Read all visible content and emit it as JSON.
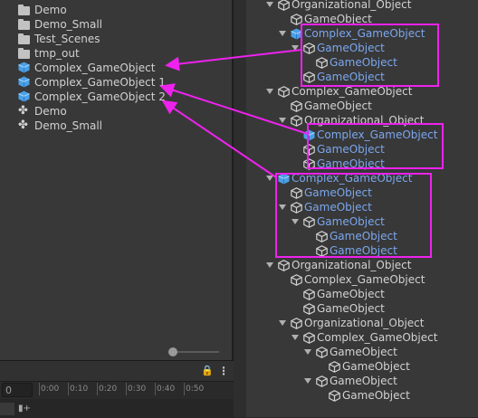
{
  "project": {
    "items": [
      {
        "label": "Demo",
        "icon": "folder-icon"
      },
      {
        "label": "Demo_Small",
        "icon": "folder-icon"
      },
      {
        "label": "Test_Scenes",
        "icon": "folder-icon"
      },
      {
        "label": "tmp_out",
        "icon": "folder-icon"
      },
      {
        "label": "Complex_GameObject",
        "icon": "prefab-cube-icon"
      },
      {
        "label": "Complex_GameObject 1",
        "icon": "prefab-cube-icon"
      },
      {
        "label": "Complex_GameObject 2",
        "icon": "prefab-cube-icon"
      },
      {
        "label": "Demo",
        "icon": "unity-scene-icon"
      },
      {
        "label": "Demo_Small",
        "icon": "unity-scene-icon"
      }
    ]
  },
  "timeline": {
    "frame_value": "0",
    "ruler_ticks": [
      "0:00",
      "0:10",
      "0:20",
      "0:30",
      "0:40",
      "0:50"
    ]
  },
  "hierarchy": {
    "rows": [
      {
        "label": "Organizational_Object",
        "depth": 0,
        "expanded": true,
        "kind": "plain",
        "color": "white"
      },
      {
        "label": "GameObject",
        "depth": 1,
        "expanded": false,
        "kind": "plain",
        "color": "white"
      },
      {
        "label": "Complex_GameObject",
        "depth": 1,
        "expanded": true,
        "kind": "prefab",
        "color": "blue"
      },
      {
        "label": "GameObject",
        "depth": 2,
        "expanded": true,
        "kind": "plain",
        "color": "blue"
      },
      {
        "label": "GameObject",
        "depth": 3,
        "expanded": false,
        "kind": "plain",
        "color": "blue"
      },
      {
        "label": "GameObject",
        "depth": 2,
        "expanded": false,
        "kind": "plain",
        "color": "blue"
      },
      {
        "label": "Complex_GameObject",
        "depth": 0,
        "expanded": true,
        "kind": "plain",
        "color": "white"
      },
      {
        "label": "GameObject",
        "depth": 1,
        "expanded": false,
        "kind": "plain",
        "color": "white"
      },
      {
        "label": "Organizational_Object",
        "depth": 1,
        "expanded": true,
        "kind": "plain",
        "color": "white"
      },
      {
        "label": "Complex_GameObject",
        "depth": 2,
        "expanded": false,
        "kind": "prefab",
        "color": "blue"
      },
      {
        "label": "GameObject",
        "depth": 2,
        "expanded": false,
        "kind": "plain",
        "color": "blue"
      },
      {
        "label": "GameObject",
        "depth": 2,
        "expanded": false,
        "kind": "plain",
        "color": "blue"
      },
      {
        "label": "Complex_GameObject",
        "depth": 0,
        "expanded": true,
        "kind": "prefab",
        "color": "blue"
      },
      {
        "label": "GameObject",
        "depth": 1,
        "expanded": false,
        "kind": "plain",
        "color": "blue"
      },
      {
        "label": "GameObject",
        "depth": 1,
        "expanded": true,
        "kind": "plain",
        "color": "blue"
      },
      {
        "label": "GameObject",
        "depth": 2,
        "expanded": true,
        "kind": "plain",
        "color": "blue"
      },
      {
        "label": "GameObject",
        "depth": 3,
        "expanded": false,
        "kind": "plain",
        "color": "blue"
      },
      {
        "label": "GameObject",
        "depth": 3,
        "expanded": false,
        "kind": "plain",
        "color": "blue"
      },
      {
        "label": "Organizational_Object",
        "depth": 0,
        "expanded": true,
        "kind": "plain",
        "color": "white"
      },
      {
        "label": "Complex_GameObject",
        "depth": 1,
        "expanded": false,
        "kind": "plain",
        "color": "white"
      },
      {
        "label": "GameObject",
        "depth": 2,
        "expanded": false,
        "kind": "plain",
        "color": "white"
      },
      {
        "label": "GameObject",
        "depth": 2,
        "expanded": false,
        "kind": "plain",
        "color": "white"
      },
      {
        "label": "Organizational_Object",
        "depth": 1,
        "expanded": true,
        "kind": "plain",
        "color": "white"
      },
      {
        "label": "Complex_GameObject",
        "depth": 2,
        "expanded": true,
        "kind": "plain",
        "color": "white"
      },
      {
        "label": "GameObject",
        "depth": 3,
        "expanded": true,
        "kind": "plain",
        "color": "white"
      },
      {
        "label": "GameObject",
        "depth": 4,
        "expanded": false,
        "kind": "plain",
        "color": "white"
      },
      {
        "label": "GameObject",
        "depth": 3,
        "expanded": true,
        "kind": "plain",
        "color": "white"
      },
      {
        "label": "GameObject",
        "depth": 4,
        "expanded": false,
        "kind": "plain",
        "color": "white"
      }
    ]
  },
  "colors": {
    "annotation": "#ee22ee",
    "prefab_text": "#7ba7ee",
    "prefab_icon": "#5fb8f0"
  }
}
